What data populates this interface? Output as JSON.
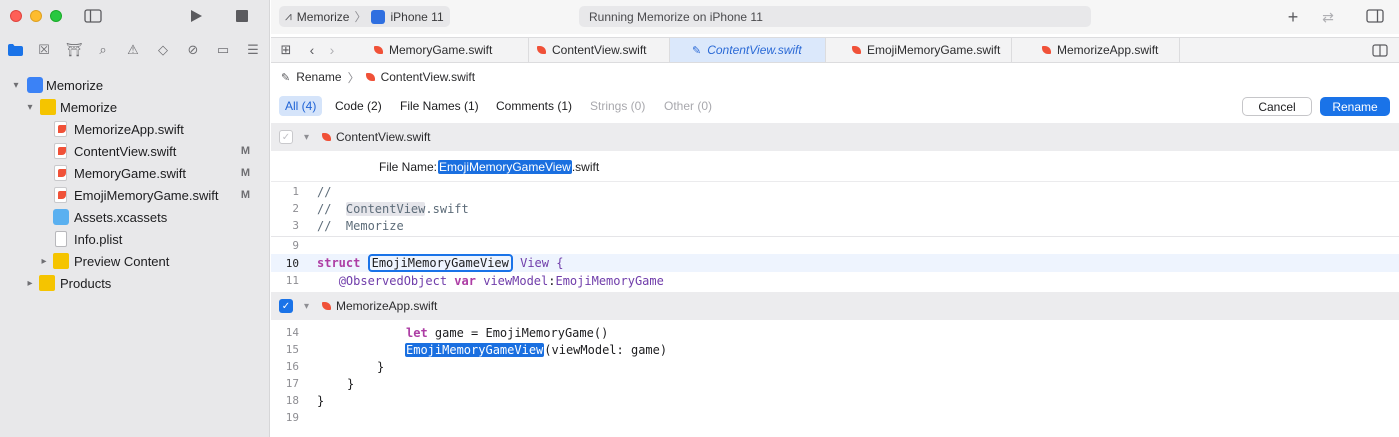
{
  "toolbar": {
    "scheme_project": "Memorize",
    "scheme_separator": "〉",
    "scheme_device": "iPhone 11",
    "status": "Running Memorize on iPhone 11"
  },
  "tabs": [
    {
      "label": "MemoryGame.swift"
    },
    {
      "label": "ContentView.swift"
    },
    {
      "label": "ContentView.swift"
    },
    {
      "label": "EmojiMemoryGame.swift"
    },
    {
      "label": "MemorizeApp.swift"
    }
  ],
  "jump_bar": {
    "action": "Rename",
    "separator": "〉",
    "file": "ContentView.swift"
  },
  "filters": {
    "all": "All (4)",
    "code": "Code (2)",
    "file_names": "File Names (1)",
    "comments": "Comments (1)",
    "strings": "Strings (0)",
    "other": "Other (0)"
  },
  "buttons": {
    "cancel": "Cancel",
    "rename": "Rename"
  },
  "sidebar": {
    "items": [
      {
        "label": "Memorize",
        "badge": ""
      },
      {
        "label": "Memorize",
        "badge": ""
      },
      {
        "label": "MemorizeApp.swift",
        "badge": ""
      },
      {
        "label": "ContentView.swift",
        "badge": "M"
      },
      {
        "label": "MemoryGame.swift",
        "badge": "M"
      },
      {
        "label": "EmojiMemoryGame.swift",
        "badge": "M"
      },
      {
        "label": "Assets.xcassets",
        "badge": ""
      },
      {
        "label": "Info.plist",
        "badge": ""
      },
      {
        "label": "Preview Content",
        "badge": ""
      },
      {
        "label": "Products",
        "badge": ""
      }
    ]
  },
  "section1": {
    "file": "ContentView.swift",
    "file_name_label": "File Name:",
    "file_name_new": "EmojiMemoryGameView",
    "file_name_ext": ".swift",
    "lines": [
      {
        "n": "1",
        "comment": "//"
      },
      {
        "n": "2",
        "comment_prefix": "//  ",
        "token": "ContentView",
        "comment_suffix": ".swift"
      },
      {
        "n": "3",
        "comment": "//  Memorize"
      },
      {
        "n": "9"
      },
      {
        "n": "10",
        "kw": "struct",
        "name": "EmojiMemoryGameView",
        "rest": " View {"
      },
      {
        "n": "11",
        "attr": "@ObservedObject",
        "kw": "var",
        "prop": "viewModel",
        "colon": ":",
        "type": "EmojiMemoryGame"
      }
    ]
  },
  "section2": {
    "file": "MemorizeApp.swift",
    "lines": [
      {
        "n": "14",
        "kw": "let",
        "rest": " game = EmojiMemoryGame()"
      },
      {
        "n": "15",
        "name": "EmojiMemoryGameView",
        "rest": "(viewModel: game)"
      },
      {
        "n": "16",
        "text": "}"
      },
      {
        "n": "17",
        "text": "}"
      },
      {
        "n": "18",
        "text": "}"
      },
      {
        "n": "19",
        "text": ""
      }
    ]
  },
  "icons": [
    "play-icon",
    "stop-icon",
    "sidebar-toggle-icon",
    "add-icon",
    "swap-icon",
    "inspector-toggle-icon",
    "grid-icon",
    "back-icon",
    "forward-icon"
  ]
}
